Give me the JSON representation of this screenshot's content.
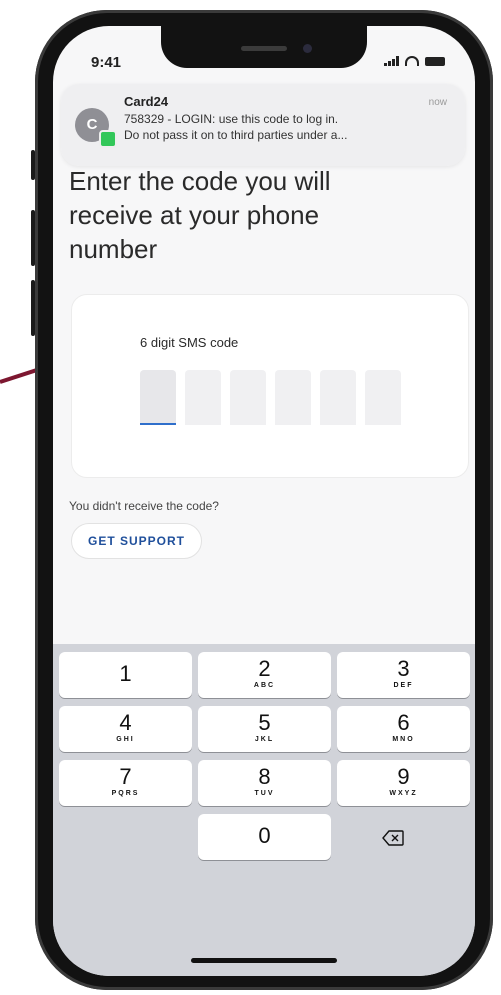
{
  "status_bar": {
    "time": "9:41"
  },
  "notification": {
    "avatar_letter": "C",
    "app_name": "Card24",
    "time": "now",
    "line1": "758329 - LOGIN: use this code to log in.",
    "line2": "Do not pass it on to third parties under a..."
  },
  "page": {
    "title": "Enter the code you will receive at your phone number",
    "code_label": "6 digit SMS code",
    "code_digits": [
      "",
      "",
      "",
      "",
      "",
      ""
    ],
    "no_code_text": "You didn't receive the code?",
    "support_button": "GET SUPPORT"
  },
  "keypad": {
    "keys": [
      {
        "num": "1",
        "letters": ""
      },
      {
        "num": "2",
        "letters": "ABC"
      },
      {
        "num": "3",
        "letters": "DEF"
      },
      {
        "num": "4",
        "letters": "GHI"
      },
      {
        "num": "5",
        "letters": "JKL"
      },
      {
        "num": "6",
        "letters": "MNO"
      },
      {
        "num": "7",
        "letters": "PQRS"
      },
      {
        "num": "8",
        "letters": "TUV"
      },
      {
        "num": "9",
        "letters": "WXYZ"
      },
      {
        "num": "0",
        "letters": ""
      }
    ],
    "backspace_icon": "backspace-icon"
  },
  "colors": {
    "accent": "#1f4f9b",
    "brand_line": "#7d1730",
    "active_underline": "#2f6fcb"
  }
}
